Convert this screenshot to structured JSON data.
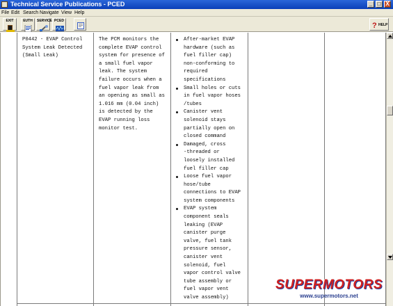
{
  "window": {
    "title": "Technical Service Publications - PCED",
    "controls": [
      "_",
      "□",
      "X"
    ]
  },
  "menu": [
    "File",
    "Edit",
    "Search",
    "Navigate",
    "View",
    "Help"
  ],
  "toolbar": {
    "buttons": [
      {
        "label": "EXIT",
        "icon": "door-icon"
      },
      {
        "label": "EUTH",
        "icon": "document-icon"
      },
      {
        "label": "SERVICE",
        "icon": "wrench-icon"
      },
      {
        "label": "PCED",
        "icon": "scope-icon"
      },
      {
        "label": "",
        "icon": "notes-icon"
      }
    ],
    "help_label": "HELP"
  },
  "table": {
    "dtc": [
      "P0442 - EVAP Control",
      "System Leak Detected",
      "(Small Leak)"
    ],
    "description": [
      "The PCM monitors the",
      "complete EVAP control",
      "system for presence of",
      "a small fuel vapor",
      "leak. The system",
      "failure occurs when a",
      "fuel vapor leak from",
      "an opening as small as",
      "1.016 mm (0.04 inch)",
      "is detected by the",
      "EVAP running loss",
      "monitor test."
    ],
    "causes": [
      [
        "After-market EVAP",
        "hardware (such as",
        "fuel filler cap)",
        "non-conforming to",
        "required",
        "specifications"
      ],
      [
        "Small holes or cuts",
        "in fuel vapor hoses",
        "/tubes"
      ],
      [
        "Canister vent",
        "solenoid stays",
        "partially open on",
        "closed command"
      ],
      [
        "Damaged, cross",
        "-threaded or",
        "loosely installed",
        "fuel filler cap"
      ],
      [
        "Loose fuel vapor",
        "hose/tube",
        "connections to EVAP",
        "system components"
      ],
      [
        "EVAP system",
        "component seals",
        "leaking (EVAP",
        "canister purge",
        "valve, fuel tank",
        "pressure sensor,",
        "canister vent",
        "solenoid, fuel",
        "vapor control valve",
        "tube assembly or",
        "fuel vapor vent",
        "valve assembly)"
      ]
    ]
  },
  "watermark": {
    "brand": "SUPERMOTORS",
    "url": "www.supermotors.net"
  }
}
